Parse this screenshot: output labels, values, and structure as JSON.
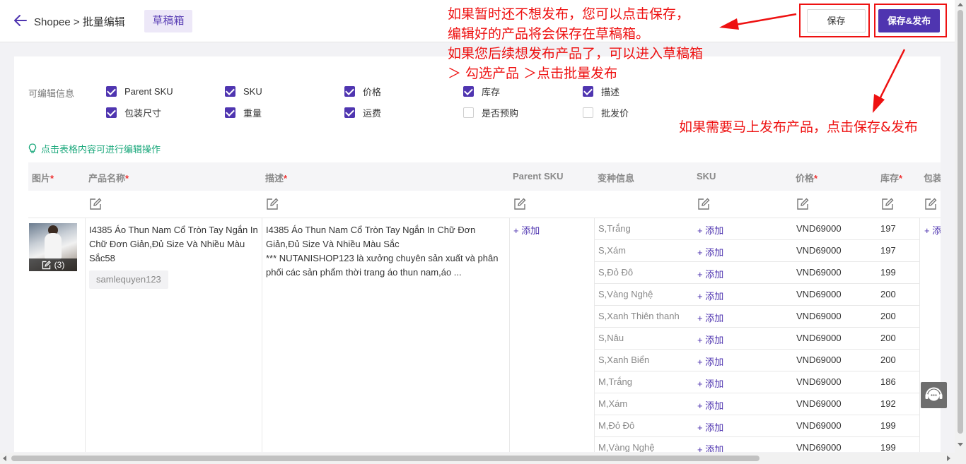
{
  "header": {
    "breadcrumb": "Shopee > 批量编辑",
    "draft_tab": "草稿箱",
    "save_label": "保存",
    "publish_label": "保存&发布"
  },
  "options": {
    "label": "可编辑信息",
    "items": [
      {
        "label": "Parent SKU",
        "checked": true
      },
      {
        "label": "SKU",
        "checked": true
      },
      {
        "label": "价格",
        "checked": true
      },
      {
        "label": "库存",
        "checked": true
      },
      {
        "label": "描述",
        "checked": true
      },
      {
        "label": "包装尺寸",
        "checked": true
      },
      {
        "label": "重量",
        "checked": true
      },
      {
        "label": "运费",
        "checked": true
      },
      {
        "label": "是否预购",
        "checked": false
      },
      {
        "label": "批发价",
        "checked": false
      }
    ]
  },
  "tip": "点击表格内容可进行编辑操作",
  "table": {
    "headers": [
      {
        "label": "图片",
        "required": "*"
      },
      {
        "label": "产品名称",
        "required": "*"
      },
      {
        "label": "描述",
        "required": "*"
      },
      {
        "label": "Parent SKU",
        "required": ""
      },
      {
        "label": "变种信息",
        "required": ""
      },
      {
        "label": "SKU",
        "required": ""
      },
      {
        "label": "价格",
        "required": "*"
      },
      {
        "label": "库存",
        "required": "*"
      },
      {
        "label": "包装尺",
        "required": ""
      }
    ],
    "product": {
      "image_count": "(3)",
      "name": "I4385 Áo Thun Nam Cổ Tròn Tay Ngắn In Chữ Đơn Giản,Đủ Size Và Nhiều Màu Sắc58",
      "shop": "samlequyen123",
      "desc_line1": "I4385 Áo Thun Nam Cổ Tròn Tay Ngắn In Chữ Đơn Giản,Đủ Size Và Nhiều Màu Sắc",
      "desc_line2": "*** NUTANISHOP123 là xưởng chuyên sản xuất và phân phối các sản phẩm thời trang áo thun nam,áo ...",
      "parent_sku_add": "+ 添加",
      "package_add": "+ 添加"
    },
    "variants": [
      {
        "name": "S,Trắng",
        "sku": "+ 添加",
        "price": "VND69000",
        "stock": "197"
      },
      {
        "name": "S,Xám",
        "sku": "+ 添加",
        "price": "VND69000",
        "stock": "197"
      },
      {
        "name": "S,Đỏ Đô",
        "sku": "+ 添加",
        "price": "VND69000",
        "stock": "199"
      },
      {
        "name": "S,Vàng Nghệ",
        "sku": "+ 添加",
        "price": "VND69000",
        "stock": "200"
      },
      {
        "name": "S,Xanh Thiên thanh",
        "sku": "+ 添加",
        "price": "VND69000",
        "stock": "200"
      },
      {
        "name": "S,Nâu",
        "sku": "+ 添加",
        "price": "VND69000",
        "stock": "200"
      },
      {
        "name": "S,Xanh Biển",
        "sku": "+ 添加",
        "price": "VND69000",
        "stock": "200"
      },
      {
        "name": "M,Trắng",
        "sku": "+ 添加",
        "price": "VND69000",
        "stock": "186"
      },
      {
        "name": "M,Xám",
        "sku": "+ 添加",
        "price": "VND69000",
        "stock": "192"
      },
      {
        "name": "M,Đỏ Đô",
        "sku": "+ 添加",
        "price": "VND69000",
        "stock": "199"
      },
      {
        "name": "M,Vàng Nghệ",
        "sku": "+ 添加",
        "price": "VND69000",
        "stock": "199"
      }
    ]
  },
  "annotations": {
    "save_note_1": "如果暂时还不想发布，您可以点击保存，",
    "save_note_2": "编辑好的产品将会保存在草稿箱。",
    "save_note_3": "如果您后续想发布产品了，可以进入草稿箱",
    "save_note_4": "＞ 勾选产品 ＞点击批量发布",
    "publish_note": "如果需要马上发布产品，点击保存&发布"
  },
  "colors": {
    "brand": "#4f35b0",
    "annotation": "#ee1111",
    "tip": "#18a77a"
  }
}
